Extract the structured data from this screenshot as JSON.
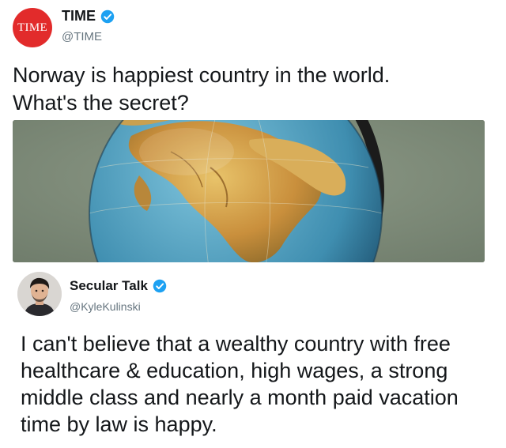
{
  "time_tweet": {
    "avatar_text": "TIME",
    "display_name": "TIME",
    "handle": "@TIME",
    "text_line1": "Norway is happiest country in the world.",
    "text_line2": "What's the secret?",
    "image_icon": "globe-photo"
  },
  "reply_tweet": {
    "display_name": "Secular Talk",
    "handle": "@KyleKulinski",
    "text": "I can't believe that a wealthy country with free healthcare & education, high wages, a strong middle class and nearly a month paid vacation time by law is happy."
  },
  "colors": {
    "time_red": "#e22b2b",
    "verified_blue": "#1da1f2",
    "handle_gray": "#66757f",
    "text_dark": "#14171a"
  },
  "icons": {
    "verified": "verified-badge-icon"
  }
}
